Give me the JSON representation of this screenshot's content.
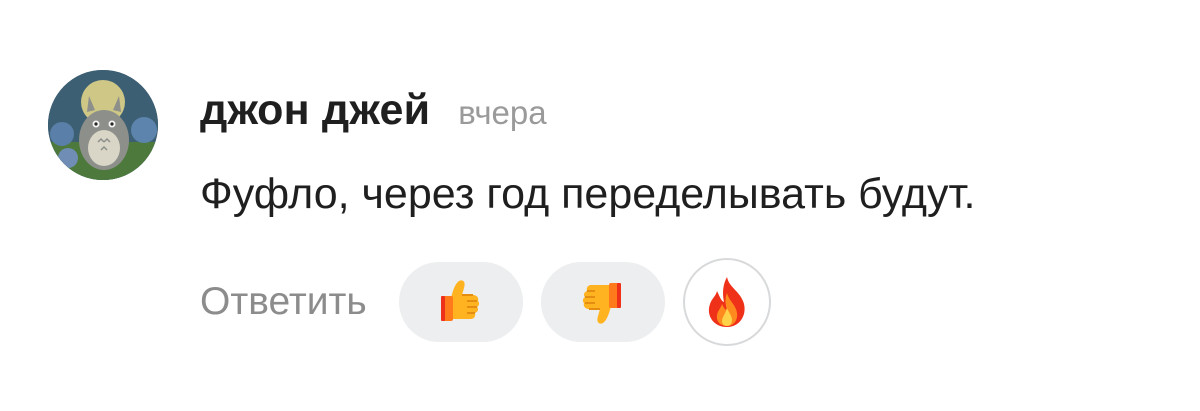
{
  "comment": {
    "author": "джон джей",
    "time": "вчера",
    "text": "Фуфло, через год переделывать будут.",
    "reply_label": "Ответить",
    "avatar_icon": "avatar-totoro",
    "reactions": [
      {
        "icon": "thumbs-up-icon"
      },
      {
        "icon": "thumbs-down-icon"
      },
      {
        "icon": "fire-icon"
      }
    ],
    "colors": {
      "reaction_bg": "#eceeef",
      "emoji_yellow": "#ffb320",
      "emoji_orange": "#ff7a1a",
      "emoji_red": "#f0311a"
    }
  }
}
